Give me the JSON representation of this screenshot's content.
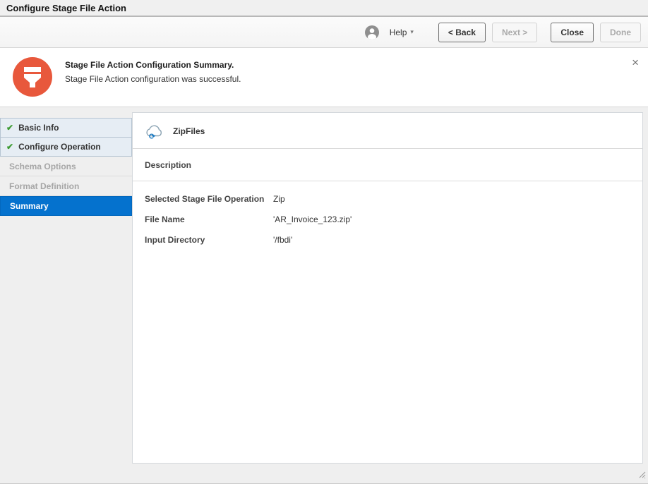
{
  "window": {
    "title": "Configure Stage File Action"
  },
  "toolbar": {
    "help_label": "Help",
    "back_button": "< Back",
    "next_button": "Next >",
    "close_button": "Close",
    "done_button": "Done"
  },
  "banner": {
    "title": "Stage File Action Configuration Summary.",
    "message": "Stage File Action configuration was successful."
  },
  "wizard": {
    "steps": [
      {
        "label": "Basic Info",
        "state": "completed"
      },
      {
        "label": "Configure Operation",
        "state": "completed"
      },
      {
        "label": "Schema Options",
        "state": "disabled"
      },
      {
        "label": "Format Definition",
        "state": "disabled"
      },
      {
        "label": "Summary",
        "state": "active"
      }
    ]
  },
  "summary": {
    "endpoint_name": "ZipFiles",
    "description_label": "Description",
    "fields": [
      {
        "label": "Selected Stage File Operation",
        "value": "Zip"
      },
      {
        "label": "File Name",
        "value": "'AR_Invoice_123.zip'"
      },
      {
        "label": "Input Directory",
        "value": "'/fbdi'"
      }
    ]
  },
  "icons": {
    "check": "✔",
    "caret": "▾",
    "close": "×",
    "refresh": "⟳"
  },
  "colors": {
    "accent_blue": "#0572CE",
    "icon_orange": "#E8583C",
    "check_green": "#3F9C35"
  }
}
